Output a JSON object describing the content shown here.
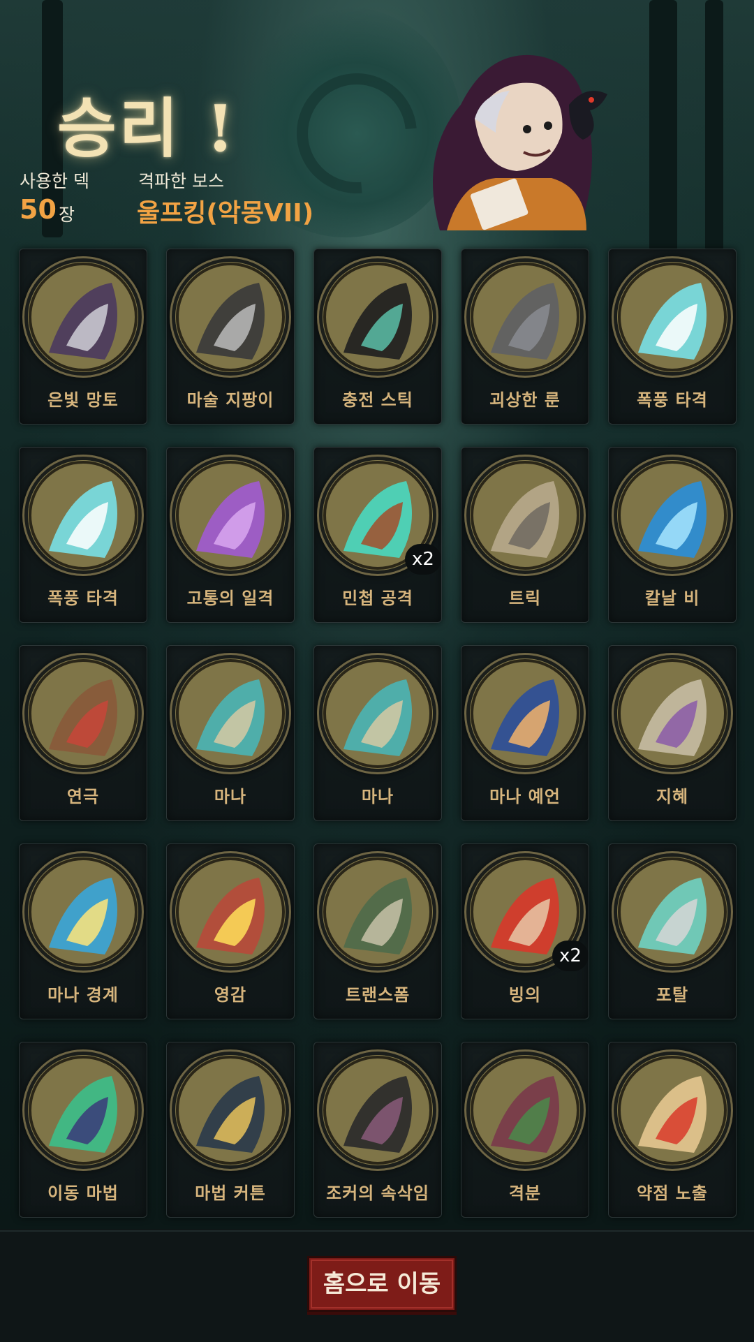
{
  "header": {
    "victory_title": "승리 !",
    "deck_label": "사용한 덱",
    "deck_count": "50",
    "deck_unit": "장",
    "boss_label": "격파한 보스",
    "boss_name": "울프킹(악몽VII)"
  },
  "cards": [
    {
      "name": "은빛 망토",
      "icon": "cloak-icon"
    },
    {
      "name": "마술 지팡이",
      "icon": "magic-staff-icon"
    },
    {
      "name": "충전 스틱",
      "icon": "charge-stick-icon"
    },
    {
      "name": "괴상한 룬",
      "icon": "strange-rune-icon"
    },
    {
      "name": "폭풍 타격",
      "icon": "storm-strike-icon"
    },
    {
      "name": "폭풍 타격",
      "icon": "storm-strike-icon"
    },
    {
      "name": "고통의 일격",
      "icon": "pain-strike-icon"
    },
    {
      "name": "민첩 공격",
      "icon": "agile-attack-icon",
      "count": "x2"
    },
    {
      "name": "트릭",
      "icon": "trick-icon"
    },
    {
      "name": "칼날 비",
      "icon": "blade-rain-icon"
    },
    {
      "name": "연극",
      "icon": "play-icon"
    },
    {
      "name": "마나",
      "icon": "mana-orb-icon"
    },
    {
      "name": "마나",
      "icon": "mana-orb-icon"
    },
    {
      "name": "마나 예언",
      "icon": "mana-prophecy-icon"
    },
    {
      "name": "지혜",
      "icon": "wisdom-icon"
    },
    {
      "name": "마나 경계",
      "icon": "mana-barrier-icon"
    },
    {
      "name": "영감",
      "icon": "inspiration-icon"
    },
    {
      "name": "트랜스폼",
      "icon": "transform-icon"
    },
    {
      "name": "빙의",
      "icon": "possession-icon",
      "count": "x2"
    },
    {
      "name": "포탈",
      "icon": "portal-icon"
    },
    {
      "name": "이동 마법",
      "icon": "teleport-magic-icon"
    },
    {
      "name": "마법 커튼",
      "icon": "magic-curtain-icon"
    },
    {
      "name": "조커의 속삭임",
      "icon": "jokers-whisper-icon"
    },
    {
      "name": "격분",
      "icon": "rage-icon"
    },
    {
      "name": "약점 노출",
      "icon": "weakness-exposed-icon"
    }
  ],
  "footer": {
    "home_button_label": "홈으로 이동"
  },
  "colors": {
    "accent_orange": "#f2a344",
    "card_name": "#d7b57d",
    "button_red": "#7e1c18"
  }
}
